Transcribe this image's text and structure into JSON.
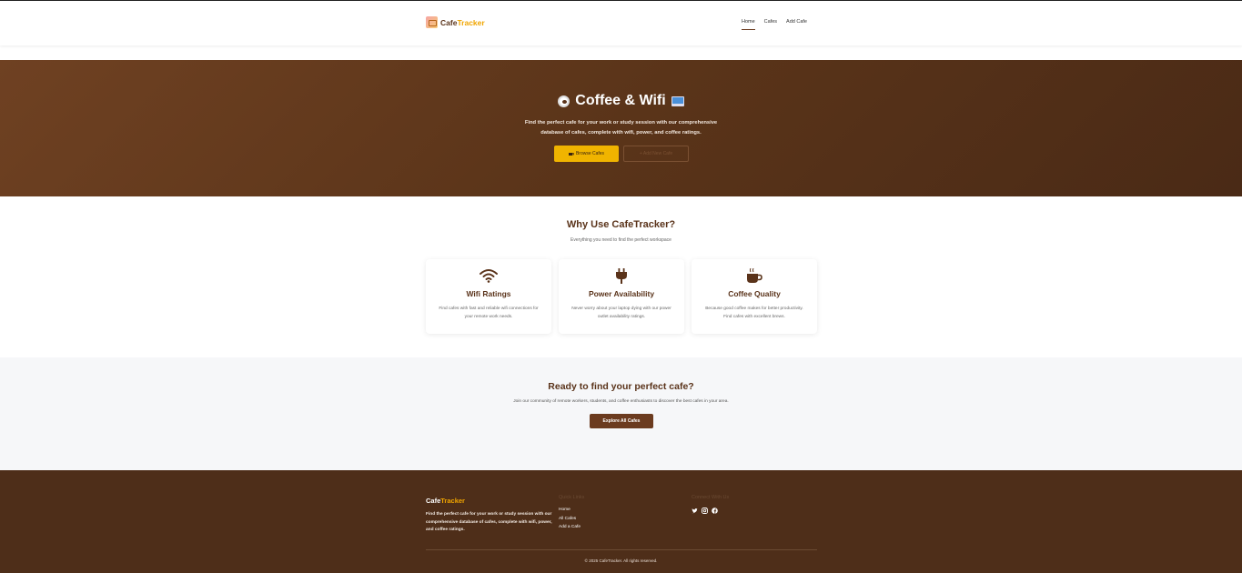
{
  "nav": {
    "brand_first": "Cafe",
    "brand_second": "Tracker",
    "links": [
      {
        "label": "Home",
        "active": true
      },
      {
        "label": "Cafes",
        "active": false
      },
      {
        "label": "Add Cafe",
        "active": false
      }
    ]
  },
  "hero": {
    "title": "Coffee & Wifi",
    "title_icons": [
      "coffee-cup-icon",
      "laptop-icon"
    ],
    "subtitle_line1": "Find the perfect cafe for your work or study session with our comprehensive",
    "subtitle_line2": "database of cafes, complete with wifi, power, and coffee ratings.",
    "primary_button": "Browse Cafes",
    "secondary_button": "+ Add New Cafe"
  },
  "features": {
    "title": "Why Use CafeTracker?",
    "subtitle": "Everything you need to find the perfect workspace",
    "cards": [
      {
        "icon": "wifi-icon",
        "title": "Wifi Ratings",
        "text": "Find cafes with fast and reliable wifi connections for your remote work needs."
      },
      {
        "icon": "plug-icon",
        "title": "Power Availability",
        "text": "Never worry about your laptop dying with our power outlet availability ratings."
      },
      {
        "icon": "coffee-icon",
        "title": "Coffee Quality",
        "text": "Because good coffee makes for better productivity. Find cafes with excellent brews."
      }
    ]
  },
  "cta": {
    "title": "Ready to find your perfect cafe?",
    "subtitle": "Join our community of remote workers, students, and coffee enthusiasts to discover the best cafes in your area.",
    "button": "Explore All Cafes"
  },
  "footer": {
    "brand_first": "Cafe",
    "brand_second": "Tracker",
    "description": "Find the perfect cafe for your work or study session with our comprehensive database of cafes, complete with wifi, power, and coffee ratings.",
    "quick_links_title": "Quick Links",
    "quick_links": [
      "Home",
      "All Cafes",
      "Add a Cafe"
    ],
    "connect_title": "Connect With Us",
    "socials": [
      "twitter-icon",
      "instagram-icon",
      "facebook-icon"
    ],
    "copyright": "© 2025 CafeTracker. All rights reserved."
  },
  "colors": {
    "primary_brown": "#6b3b1f",
    "accent_gold": "#f0b400",
    "footer_bg": "#4e2e19"
  }
}
